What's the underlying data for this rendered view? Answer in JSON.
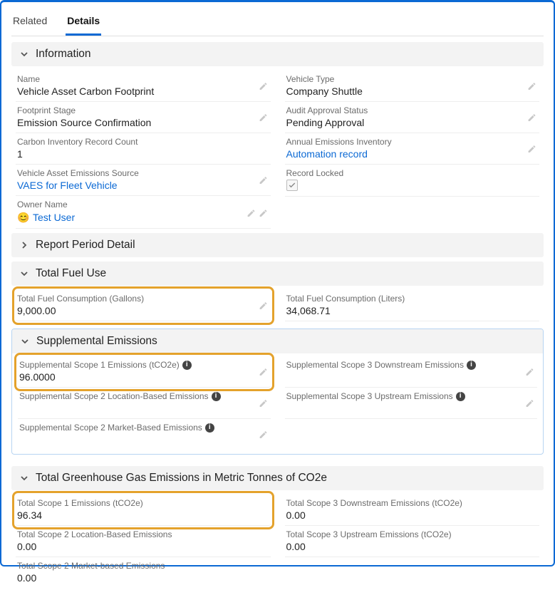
{
  "tabs": {
    "related": "Related",
    "details": "Details"
  },
  "sections": {
    "information": "Information",
    "report_period": "Report Period Detail",
    "total_fuel": "Total Fuel Use",
    "supplemental": "Supplemental Emissions",
    "ghg": "Total Greenhouse Gas Emissions in Metric Tonnes of CO2e"
  },
  "info": {
    "name_label": "Name",
    "name_value": "Vehicle Asset Carbon Footprint",
    "vehicle_type_label": "Vehicle Type",
    "vehicle_type_value": "Company Shuttle",
    "stage_label": "Footprint Stage",
    "stage_value": "Emission Source Confirmation",
    "audit_label": "Audit Approval Status",
    "audit_value": "Pending Approval",
    "carbon_inv_label": "Carbon Inventory Record Count",
    "carbon_inv_value": "1",
    "annual_inv_label": "Annual Emissions Inventory",
    "annual_inv_value": "Automation record",
    "source_label": "Vehicle Asset Emissions Source",
    "source_value": "VAES for Fleet Vehicle",
    "locked_label": "Record Locked",
    "owner_label": "Owner Name",
    "owner_value": "Test User"
  },
  "fuel": {
    "gallons_label": "Total Fuel Consumption (Gallons)",
    "gallons_value": "9,000.00",
    "liters_label": "Total Fuel Consumption (Liters)",
    "liters_value": "34,068.71"
  },
  "supp": {
    "s1_label": "Supplemental Scope 1 Emissions (tCO2e)",
    "s1_value": "96.0000",
    "s3down_label": "Supplemental Scope 3 Downstream Emissions",
    "s2loc_label": "Supplemental Scope 2 Location-Based Emissions",
    "s3up_label": "Supplemental Scope 3 Upstream Emissions",
    "s2mkt_label": "Supplemental Scope 2 Market-Based Emissions"
  },
  "ghg": {
    "s1_label": "Total Scope 1 Emissions (tCO2e)",
    "s1_value": "96.34",
    "s3down_label": "Total Scope 3 Downstream Emissions (tCO2e)",
    "s3down_value": "0.00",
    "s2loc_label": "Total Scope 2 Location-Based Emissions",
    "s2loc_value": "0.00",
    "s3up_label": "Total Scope 3 Upstream Emissions (tCO2e)",
    "s3up_value": "0.00",
    "s2mkt_label": "Total Scope 2 Market-based Emissions",
    "s2mkt_value": "0.00"
  }
}
